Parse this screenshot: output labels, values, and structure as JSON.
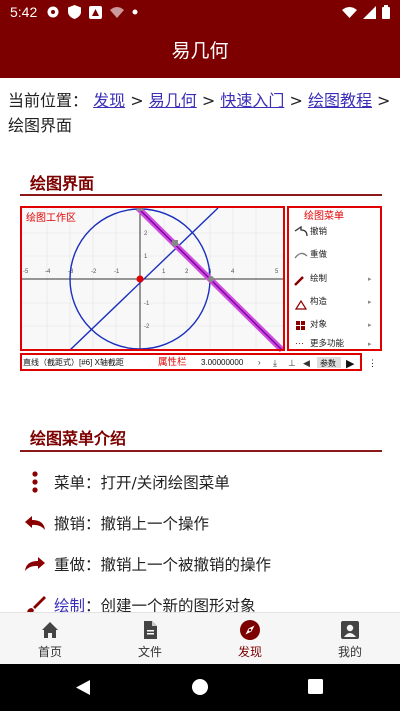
{
  "status": {
    "time": "5:42"
  },
  "appbar": {
    "title": "易几何"
  },
  "breadcrumb": {
    "prefix": "当前位置：",
    "links": [
      "发现",
      "易几何",
      "快速入门",
      "绘图教程"
    ],
    "separator": ">",
    "current": "绘图界面"
  },
  "section1": {
    "title": "绘图界面"
  },
  "figure": {
    "work_area_label": "绘图工作区",
    "menu_label": "绘图菜单",
    "menu_items": [
      "撤销",
      "重做",
      "绘制",
      "构造",
      "对象",
      "更多功能"
    ],
    "x_ticks": [
      "-5",
      "-4",
      "-3",
      "-2",
      "-1",
      "1",
      "2",
      "3",
      "4",
      "5"
    ],
    "y_ticks": [
      "2",
      "1",
      "-1",
      "-2"
    ],
    "attr_bar": {
      "object_label": "直线（截距式）[#6] X轴截距",
      "attr_label": "属性栏",
      "value": "3.00000000",
      "params_button": "参数"
    }
  },
  "section2": {
    "title": "绘图菜单介绍"
  },
  "menu_intro": [
    {
      "icon": "vertical-dots-icon",
      "name": "菜单",
      "desc": "：打开/关闭绘图菜单"
    },
    {
      "icon": "undo-icon",
      "name": "撤销",
      "desc": "：撤销上一个操作"
    },
    {
      "icon": "redo-icon",
      "name": "重做",
      "desc": "：撤销上一个被撤销的操作"
    },
    {
      "icon": "brush-icon",
      "name": "绘制",
      "desc": "：创建一个新的图形对象"
    }
  ],
  "bottom_nav": [
    {
      "label": "首页",
      "icon": "home-icon"
    },
    {
      "label": "文件",
      "icon": "file-icon"
    },
    {
      "label": "发现",
      "icon": "compass-icon",
      "active": true
    },
    {
      "label": "我的",
      "icon": "account-icon"
    }
  ],
  "colors": {
    "primary": "#7d0000",
    "link": "#3b2fb8",
    "annotation": "#e00000"
  }
}
